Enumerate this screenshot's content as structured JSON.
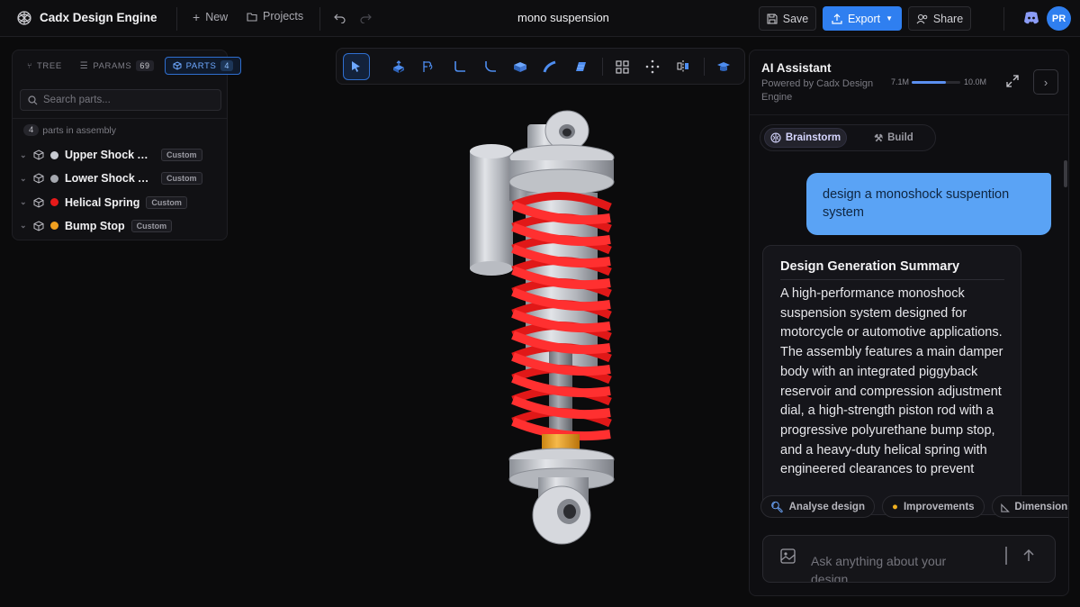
{
  "header": {
    "app_title": "Cadx Design Engine",
    "new_label": "New",
    "projects_label": "Projects",
    "doc_title": "mono suspension",
    "save_label": "Save",
    "export_label": "Export",
    "share_label": "Share",
    "avatar_initials": "PR"
  },
  "left_panel": {
    "tabs": [
      {
        "label": "TREE",
        "count": ""
      },
      {
        "label": "PARAMS",
        "count": "69"
      },
      {
        "label": "PARTS",
        "count": "4"
      }
    ],
    "search_placeholder": "Search parts...",
    "parts_count": "4",
    "parts_count_label": "parts in assembly",
    "parts": [
      {
        "name": "Upper Shock Assembly",
        "color": "#c8cbd2",
        "tag": "Custom"
      },
      {
        "name": "Lower Shock Assembly",
        "color": "#a6a9b0",
        "tag": "Custom"
      },
      {
        "name": "Helical Spring",
        "color": "#e61a1a",
        "tag": "Custom"
      },
      {
        "name": "Bump Stop",
        "color": "#f0a020",
        "tag": "Custom"
      }
    ]
  },
  "toolbar": {
    "tools": [
      "select-icon",
      "extrude-icon",
      "revolve-icon",
      "fillet-icon",
      "chamfer-icon",
      "box-icon",
      "sweep-icon",
      "loft-icon",
      "pattern-icon",
      "move-icon",
      "mirror-icon",
      "measure-icon"
    ]
  },
  "ai_panel": {
    "title": "AI Assistant",
    "subtitle": "Powered by Cadx Design Engine",
    "usage_used": "7.1M",
    "usage_total": "10.0M",
    "usage_fraction": 0.71,
    "modes": [
      "Brainstorm",
      "Build"
    ],
    "user_message": "design a monoshock suspention system",
    "response_title": "Design Generation Summary",
    "response_body": "A high-performance monoshock suspension system designed for motorcycle or automotive applications. The assembly features a main damper body with an integrated piggyback reservoir and compression adjustment dial, a high-strength piston rod with a progressive polyurethane bump stop, and a heavy-duty helical spring with engineered clearances to prevent",
    "chips": [
      "Analyse design",
      "Improvements",
      "Dimensions"
    ],
    "input_placeholder": "Ask anything about your design..."
  },
  "colors": {
    "accent": "#2f7ff0",
    "user_bubble": "#5aa3f5",
    "spring": "#e61a1a",
    "bump_stop": "#f0a020"
  }
}
